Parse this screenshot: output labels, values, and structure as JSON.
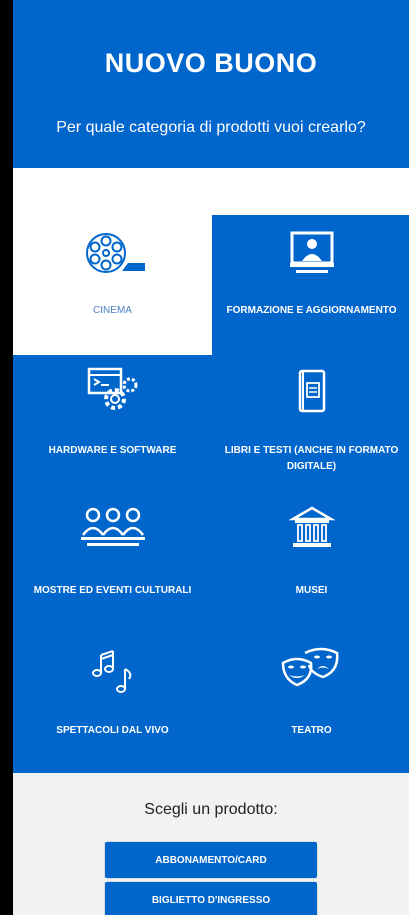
{
  "header": {
    "title": "NUOVO BUONO",
    "subtitle": "Per quale categoria di prodotti vuoi crearlo?"
  },
  "categories": [
    {
      "label": "CINEMA",
      "icon": "film-reel-icon",
      "selected": true
    },
    {
      "label": "FORMAZIONE E AGGIORNAMENTO",
      "icon": "presentation-icon",
      "selected": false
    },
    {
      "label": "HARDWARE E SOFTWARE",
      "icon": "code-gear-icon",
      "selected": false
    },
    {
      "label": "LIBRI E TESTI (ANCHE IN FORMATO DIGITALE)",
      "icon": "book-icon",
      "selected": false
    },
    {
      "label": "MOSTRE ED EVENTI CULTURALI",
      "icon": "people-icon",
      "selected": false
    },
    {
      "label": "MUSEI",
      "icon": "museum-icon",
      "selected": false
    },
    {
      "label": "SPETTACOLI DAL VIVO",
      "icon": "music-notes-icon",
      "selected": false
    },
    {
      "label": "TEATRO",
      "icon": "theater-masks-icon",
      "selected": false
    }
  ],
  "product": {
    "prompt": "Scegli un prodotto:",
    "options": [
      "ABBONAMENTO/CARD",
      "BIGLIETTO D'INGRESSO"
    ]
  },
  "colors": {
    "primary": "#0066cc",
    "background": "#ffffff",
    "selected_text": "#4a7ec4"
  }
}
